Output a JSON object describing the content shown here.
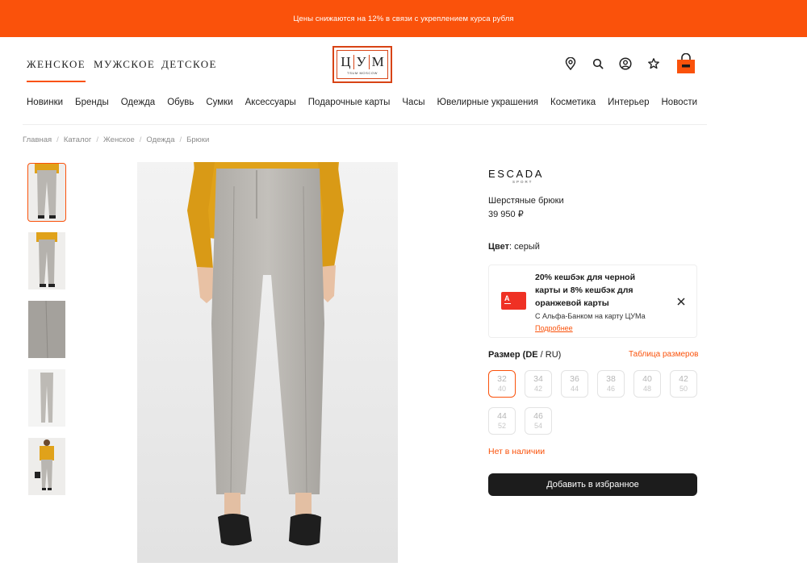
{
  "promo_banner": "Цены снижаются на 12% в связи с укреплением курса рубля",
  "header": {
    "gender_tabs": [
      {
        "label": "ЖЕНСКОЕ",
        "active": true
      },
      {
        "label": "МУЖСКОЕ",
        "active": false
      },
      {
        "label": "ДЕТСКОЕ",
        "active": false
      }
    ],
    "logo": {
      "letters": [
        "Ц",
        "У",
        "М"
      ],
      "subtitle": "TSUM MOSCOW"
    },
    "icons": [
      "location-pin-icon",
      "search-icon",
      "user-icon",
      "favorites-star-icon",
      "cart-bag-icon"
    ]
  },
  "nav": [
    "Новинки",
    "Бренды",
    "Одежда",
    "Обувь",
    "Сумки",
    "Аксессуары",
    "Подарочные карты",
    "Часы",
    "Ювелирные украшения",
    "Косметика",
    "Интерьер",
    "Новости"
  ],
  "breadcrumbs": [
    "Главная",
    "Каталог",
    "Женское",
    "Одежда",
    "Брюки"
  ],
  "gallery": {
    "thumbnails": [
      "front-worn",
      "side-worn",
      "fabric-closeup",
      "flat-lay",
      "full-look"
    ],
    "active_thumbnail": 0
  },
  "product": {
    "brand": "ESCADA",
    "brand_sub": "SPORT",
    "name": "Шерстяные брюки",
    "price": "39 950 ₽",
    "color_label": "Цвет",
    "color_value": ": серый"
  },
  "promo_card": {
    "title": "20% кешбэк для черной карты и 8% кешбэк для оранжевой карты",
    "subtitle": "С Альфа-Банком на карту ЦУМа",
    "link": "Подробнее",
    "bank_logo_letter": "А"
  },
  "sizes": {
    "label_bold": "Размер (DE",
    "label_rest": " / RU)",
    "table_link": "Таблица размеров",
    "items": [
      {
        "de": "32",
        "ru": "40",
        "selected": true
      },
      {
        "de": "34",
        "ru": "42",
        "selected": false
      },
      {
        "de": "36",
        "ru": "44",
        "selected": false
      },
      {
        "de": "38",
        "ru": "46",
        "selected": false
      },
      {
        "de": "40",
        "ru": "48",
        "selected": false
      },
      {
        "de": "42",
        "ru": "50",
        "selected": false
      },
      {
        "de": "44",
        "ru": "52",
        "selected": false
      },
      {
        "de": "46",
        "ru": "54",
        "selected": false
      }
    ]
  },
  "stock_status": "Нет в наличии",
  "add_to_favorites": "Добавить в избранное",
  "colors": {
    "accent": "#fa520b",
    "button": "#1c1c1c",
    "alfa_red": "#ef3124",
    "sweater": "#e0a21a",
    "pants": "#b8b5b0"
  }
}
